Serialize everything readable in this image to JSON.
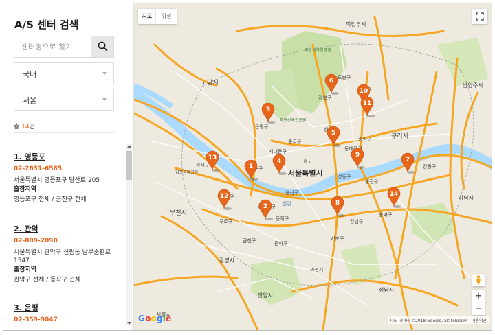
{
  "sidebar": {
    "title": "A/S 센터 검색",
    "search_placeholder": "센터명으로 찾기",
    "country_select": "국내",
    "city_select": "서울",
    "total_prefix": "총 ",
    "total_count": "14",
    "total_suffix": "건"
  },
  "centers": [
    {
      "name": "1. 영등포",
      "phone": "02-2631-6585",
      "address": "서울특별시 영등포구 당산로 205",
      "area_title": "출장지역",
      "area": "영등포구 전체 / 금천구 전체"
    },
    {
      "name": "2. 관악",
      "phone": "02-889-2090",
      "address": "서울특별시 관악구 신림동 남부순환로 1547",
      "area_title": "출장지역",
      "area": "관악구 전체 / 동작구 전체"
    },
    {
      "name": "3. 은평",
      "phone": "02-359-9047"
    }
  ],
  "map": {
    "type_map": "지도",
    "type_satellite": "위성",
    "attribution": "지도 데이터 ©2018 Google, SK telecom",
    "terms": "이용약관",
    "google_logo": "Google",
    "zoom_in": "+",
    "zoom_out": "−",
    "colors": {
      "pin": "#e8661c",
      "road": "#f5a623",
      "river": "#aadaff",
      "park": "#c8dfa8",
      "land": "#eeeae0"
    },
    "pins": [
      "1",
      "2",
      "3",
      "4",
      "5",
      "6",
      "7",
      "8",
      "9",
      "10",
      "11",
      "12",
      "13",
      "14"
    ],
    "places": {
      "seoul": "서울특별시",
      "uijeongbu": "의정부시",
      "goyang": "고양시",
      "guri": "구리시",
      "namyangju": "남양주시",
      "hanam": "하남시",
      "bucheon": "부천시",
      "gwangmyeong": "광명시",
      "anyang": "안양시",
      "gwacheon": "과천시",
      "seongnam": "성남시",
      "siheung": "시흥시",
      "bukhansan": "북한산국립공원",
      "bukhansan2": "북한산국립공원",
      "gangnam": "강남구",
      "gangseo": "강서구",
      "mapo": "마포구",
      "yongsan": "용산구",
      "dongjak": "동작구",
      "gwanak": "관악구",
      "seocho": "서초구",
      "songpa": "송파구",
      "gangdong": "강동구",
      "gwangjin": "광진구",
      "seongdong": "성동구",
      "jung": "중구",
      "jongno": "종로구",
      "seodaemun": "서대문구",
      "eunpyeong": "은평구",
      "dobong": "도봉구",
      "nowon": "노원구",
      "gangbuk": "강북구",
      "jungnang": "중랑구",
      "dongdaemun": "동대문구",
      "seongbuk": "성북구",
      "yangcheon": "양천구",
      "guro": "구로구",
      "geumcheon": "금천구",
      "yeongdeungpo": "영등포구",
      "hangang": "한강",
      "gimpo_airport": "김포국제공항"
    }
  }
}
